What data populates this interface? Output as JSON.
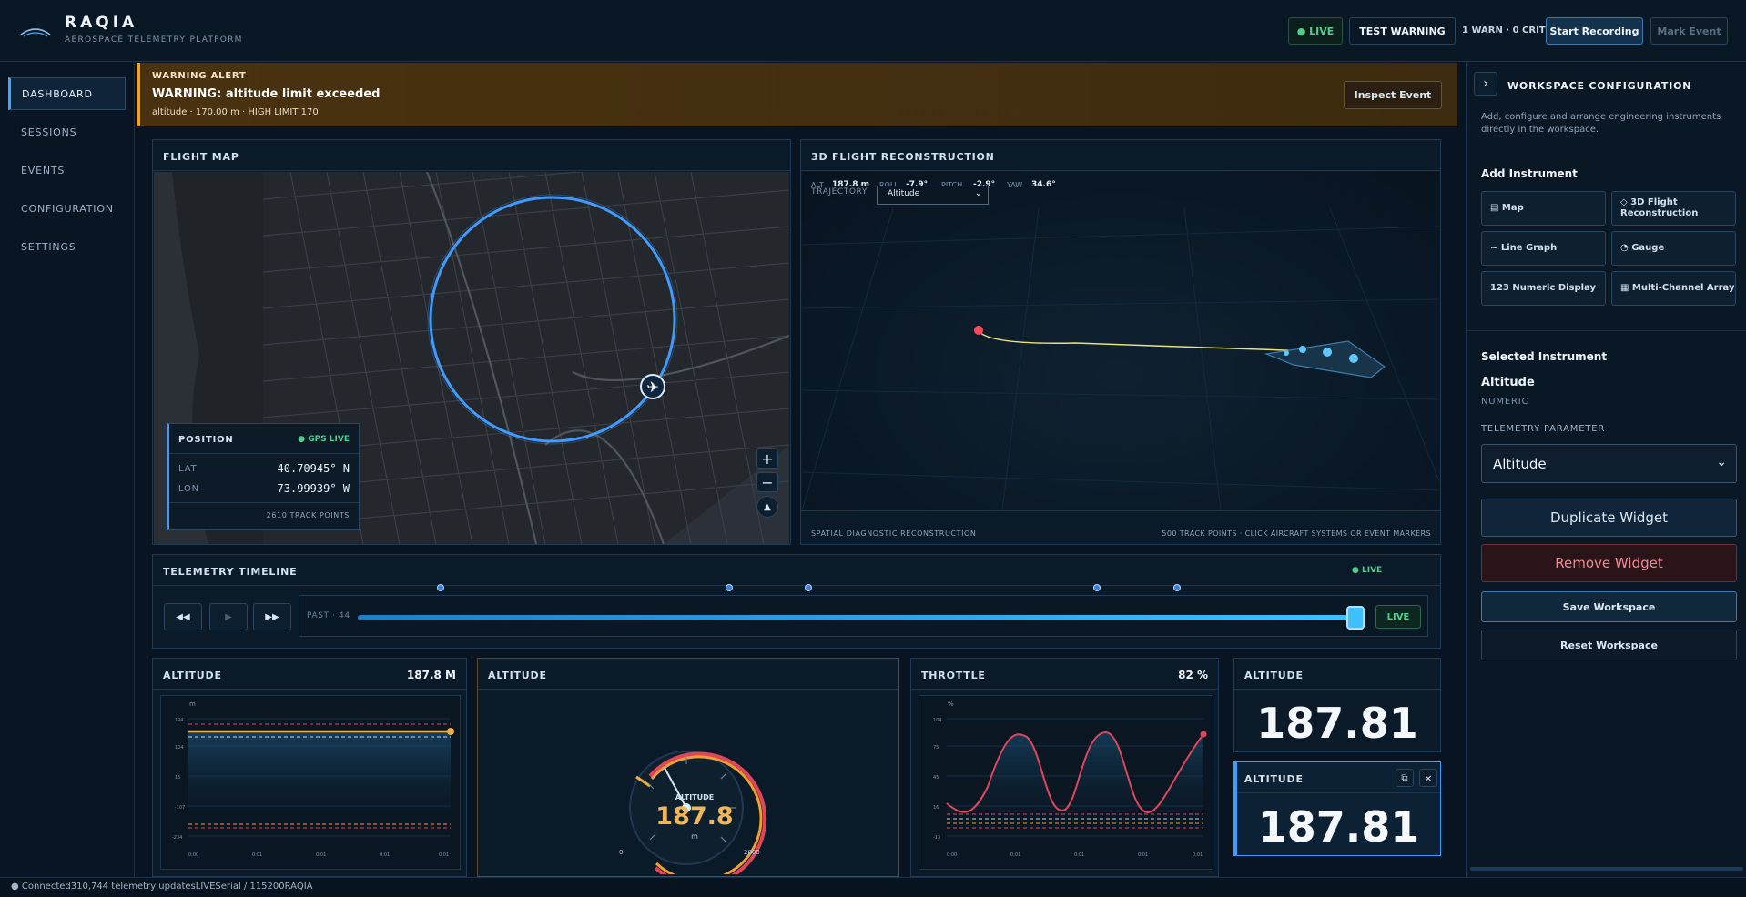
{
  "app": {
    "name": "RAQIA",
    "subtitle": "AEROSPACE TELEMETRY PLATFORM"
  },
  "topbar": {
    "live_label": "● LIVE",
    "test_warning_label": "TEST WARNING",
    "warn_summary": "1 WARN · 0 CRIT",
    "start_recording_label": "Start Recording",
    "mark_event_label": "Mark Event"
  },
  "sidebar": {
    "items": [
      {
        "label": "DASHBOARD",
        "active": true
      },
      {
        "label": "SESSIONS"
      },
      {
        "label": "EVENTS"
      },
      {
        "label": "CONFIGURATION"
      },
      {
        "label": "SETTINGS"
      }
    ]
  },
  "alert": {
    "kicker": "WARNING ALERT",
    "title": "WARNING: altitude limit exceeded",
    "detail": "altitude · 170.00 m · HIGH LIMIT 170",
    "inspect_label": "Inspect Event"
  },
  "flight_map": {
    "title": "FLIGHT MAP",
    "position_title": "POSITION",
    "gps_status": "● GPS LIVE",
    "lat_label": "LAT",
    "lat_value": "40.70945° N",
    "lon_label": "LON",
    "lon_value": "73.99939° W",
    "track_points": "2610 TRACK POINTS",
    "zoom_in": "+",
    "zoom_out": "−",
    "compass": "▲"
  },
  "reconstruction": {
    "title": "3D FLIGHT RECONSTRUCTION",
    "alt_label": "ALT",
    "alt_value": "187.8 m",
    "roll_label": "ROLL",
    "roll_value": "-7.9°",
    "pitch_label": "PITCH",
    "pitch_value": "-2.9°",
    "yaw_label": "YAW",
    "yaw_value": "34.6°",
    "trajectory_label": "TRAJECTORY",
    "trajectory_value": "Altitude",
    "footer_left": "SPATIAL DIAGNOSTIC RECONSTRUCTION",
    "footer_right": "500 TRACK POINTS · CLICK AIRCRAFT SYSTEMS OR EVENT MARKERS"
  },
  "timeline": {
    "title": "TELEMETRY TIMELINE",
    "status": "● LIVE",
    "rewind": "◀◀",
    "play": "▶",
    "forward": "▶▶",
    "past_label": "PAST · 44",
    "live_button": "LIVE",
    "position": 1.0,
    "event_markers": [
      0.083,
      0.372,
      0.452,
      0.741,
      0.821
    ]
  },
  "widgets": {
    "altitude_chart": {
      "title": "ALTITUDE",
      "value": "187.8 M",
      "unit_label": "m"
    },
    "gauge": {
      "title": "ALTITUDE",
      "label": "ALTITUDE",
      "value": "187.8",
      "unit": "m",
      "min": "0",
      "max": "2000"
    },
    "throttle": {
      "title": "THROTTLE",
      "value": "82 %",
      "unit_label": "%"
    },
    "numeric1": {
      "title": "ALTITUDE",
      "value": "187.81"
    },
    "numeric2": {
      "title": "ALTITUDE",
      "value": "187.81"
    }
  },
  "right_panel": {
    "title": "WORKSPACE CONFIGURATION",
    "collapse_icon": "›",
    "description": "Add, configure and arrange engineering instruments directly in the workspace.",
    "add_title": "Add Instrument",
    "instruments": [
      "▤ Map",
      "◇ 3D Flight Reconstruction",
      "~ Line Graph",
      "◔ Gauge",
      "123 Numeric Display",
      "▦ Multi-Channel Array"
    ],
    "selected_title": "Selected Instrument",
    "selected_name": "Altitude",
    "selected_type": "NUMERIC",
    "param_label": "TELEMETRY PARAMETER",
    "param_value": "Altitude",
    "duplicate_label": "Duplicate Widget",
    "remove_label": "Remove Widget",
    "save_label": "Save Workspace",
    "reset_label": "Reset Workspace"
  },
  "statusbar": {
    "text": "● Connected310,744 telemetry updatesLIVESerial / 115200RAQIA"
  },
  "colors": {
    "accent": "#3ea8ff",
    "warning": "#f0a030",
    "danger": "#e0465a",
    "live": "#4ed08a"
  }
}
